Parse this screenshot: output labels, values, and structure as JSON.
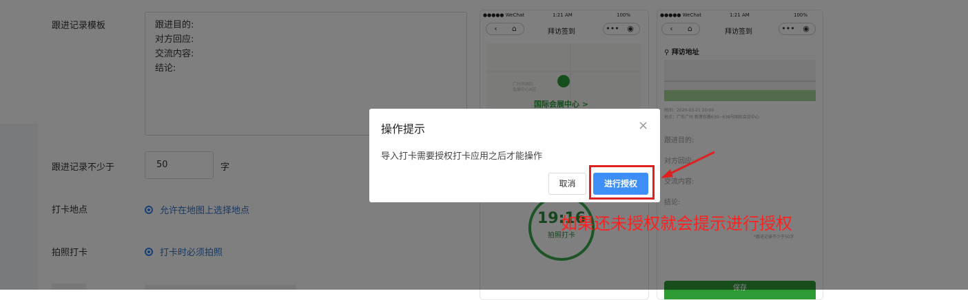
{
  "form": {
    "template_label": "跟进记录模板",
    "template_lines": [
      "跟进目的:",
      "对方回应:",
      "交流内容:",
      "结论:"
    ],
    "min_label": "跟进记录不少于",
    "min_value": "50",
    "min_unit": "字",
    "location_label": "打卡地点",
    "location_option": "允许在地图上选择地点",
    "photo_label": "拍照打卡",
    "photo_option": "打卡时必须拍照"
  },
  "phone_left": {
    "carrier": "●●●●● WeChat",
    "time": "1:21 AM",
    "battery": "100%",
    "title": "拜访签到",
    "map_place": "国际会展中心 >",
    "map_caption1": "广州市国际",
    "map_caption2": "会展中心A区",
    "clock_time": "19:16",
    "clock_label": "拍照打卡"
  },
  "phone_right": {
    "carrier": "●●●●● WeChat",
    "time": "1:21 AM",
    "battery": "100%",
    "title": "拜访签到",
    "section": "拜访地址",
    "visit_time": "时间：2020-03-21 10:00",
    "visit_addr": "地点：广东广州 新港东路630~638号国际会议中心",
    "fields": [
      "跟进目的:",
      "对方回应:",
      "交流内容:",
      "结论:"
    ],
    "note": "*跟进记录不少于50字",
    "save": "保存"
  },
  "modal": {
    "title": "操作提示",
    "close": "×",
    "message": "导入打卡需要授权打卡应用之后才能操作",
    "cancel": "取消",
    "confirm": "进行授权"
  },
  "annotation": {
    "text": "如果还未授权就会提示进行授权",
    "color": "#ff2020"
  }
}
